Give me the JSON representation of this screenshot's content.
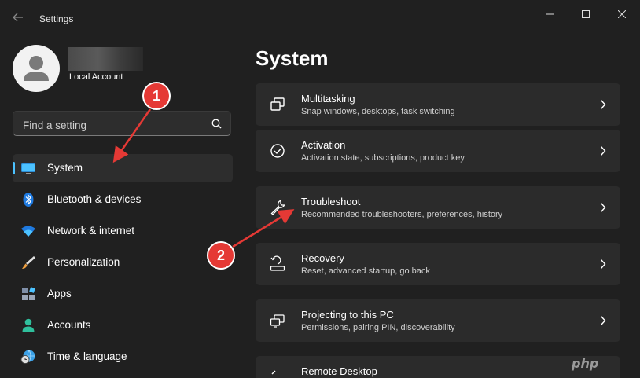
{
  "window": {
    "title": "Settings"
  },
  "user": {
    "account_label": "Local Account"
  },
  "search": {
    "placeholder": "Find a setting"
  },
  "sidebar": {
    "items": [
      {
        "label": "System",
        "icon": "monitor-icon",
        "active": true
      },
      {
        "label": "Bluetooth & devices",
        "icon": "bluetooth-icon"
      },
      {
        "label": "Network & internet",
        "icon": "wifi-icon"
      },
      {
        "label": "Personalization",
        "icon": "brush-icon"
      },
      {
        "label": "Apps",
        "icon": "apps-icon"
      },
      {
        "label": "Accounts",
        "icon": "person-icon"
      },
      {
        "label": "Time & language",
        "icon": "globe-clock-icon"
      }
    ]
  },
  "main": {
    "title": "System",
    "cards": [
      {
        "title": "Multitasking",
        "subtitle": "Snap windows, desktops, task switching",
        "icon": "multitasking-icon"
      },
      {
        "title": "Activation",
        "subtitle": "Activation state, subscriptions, product key",
        "icon": "check-circle-icon"
      },
      {
        "title": "Troubleshoot",
        "subtitle": "Recommended troubleshooters, preferences, history",
        "icon": "wrench-icon"
      },
      {
        "title": "Recovery",
        "subtitle": "Reset, advanced startup, go back",
        "icon": "recovery-icon"
      },
      {
        "title": "Projecting to this PC",
        "subtitle": "Permissions, pairing PIN, discoverability",
        "icon": "projecting-icon"
      },
      {
        "title": "Remote Desktop",
        "subtitle": "",
        "icon": "remote-desktop-icon"
      }
    ]
  },
  "annotations": {
    "step1": "1",
    "step2": "2",
    "color": "#e53935"
  },
  "watermark": "php",
  "colors": {
    "accent": "#4cc2ff",
    "background": "#202020",
    "card": "#2b2b2b"
  }
}
